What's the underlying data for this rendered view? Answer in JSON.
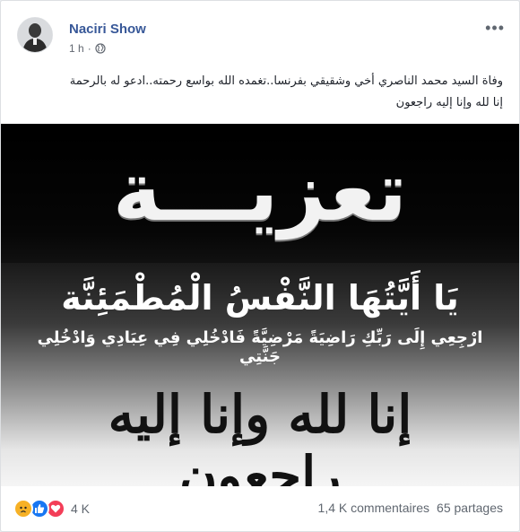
{
  "post": {
    "author": "Naciri Show",
    "time": "1 h",
    "separator": "·",
    "privacy_icon": "globe-icon",
    "more_icon": "more-options-icon",
    "text_lines": [
      "وفاة السيد محمد الناصري أخي وشقيقي بفرنسا..تغمده الله بواسع رحمته..ادعو له بالرحمة",
      "إنا لله وإنا إليه راجعون"
    ]
  },
  "photo": {
    "title": "تعزيـــة",
    "verse_main": "يَا أَيَّتُهَا النَّفْسُ الْمُطْمَئِنَّة",
    "verse_sub": "ارْجِعِي إِلَى رَبِّكِ رَاضِيَةً مَرْضِيَّةً فَادْخُلِي فِي عِبَادِي وَادْخُلِي جَنَّتِي",
    "calligraphy": "إنا لله وإنا إليه راجعون"
  },
  "footer": {
    "reactions": [
      "sad-icon",
      "like-icon",
      "love-icon"
    ],
    "reaction_count": "4 K",
    "comments": "1,4 K commentaires",
    "shares": "65 partages"
  },
  "colors": {
    "author": "#385898",
    "muted": "#616770",
    "like": "#1877f2",
    "love": "#f33e58",
    "sad": "#f7b125"
  }
}
